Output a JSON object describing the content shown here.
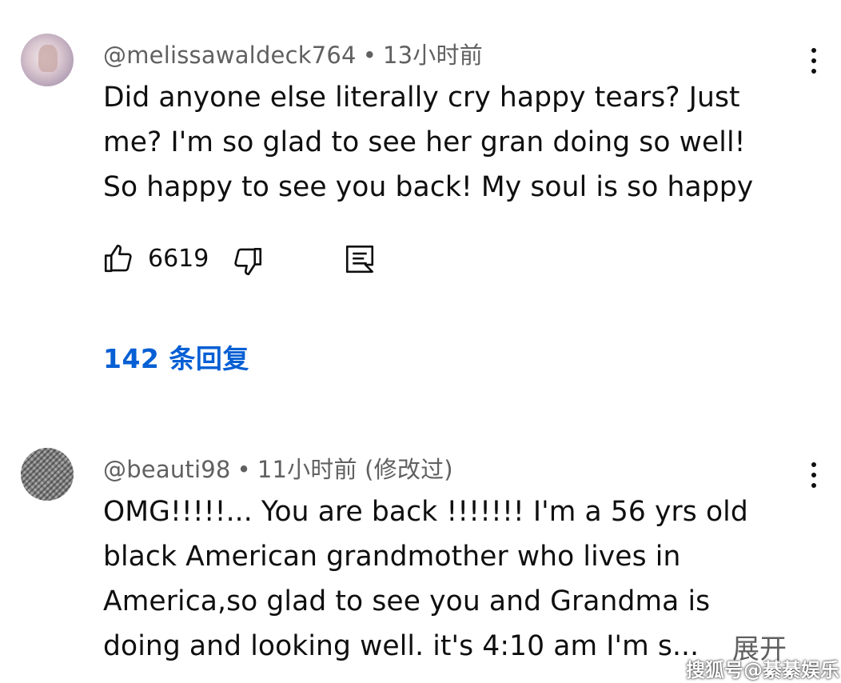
{
  "comments": [
    {
      "username": "@melissawaldeck764",
      "separator": "•",
      "time": "13小时前",
      "edited": "",
      "text": "Did anyone else literally cry happy tears? Just\nme? I'm so glad to see her gran doing so well!\nSo happy to see you back! My soul is so happy",
      "likes": "6619",
      "replies_label": "142 条回复"
    },
    {
      "username": "@beauti98",
      "separator": "•",
      "time": "11小时前",
      "edited": "(修改过)",
      "text": "OMG!!!!!... You are back !!!!!!! I'm a 56 yrs old\nblack American grandmother who lives in\nAmerica,so glad to see you and  Grandma is\ndoing and looking well. it's 4:10 am  I'm s...",
      "expand_label": "展开"
    }
  ],
  "icons": {
    "like": "thumbs-up-icon",
    "dislike": "thumbs-down-icon",
    "reply": "reply-comment-icon",
    "more": "more-vertical-icon"
  },
  "colors": {
    "link": "#065fd4",
    "meta": "#606060",
    "text": "#0f0f0f"
  },
  "watermark": "搜狐号@綦綦娱乐"
}
